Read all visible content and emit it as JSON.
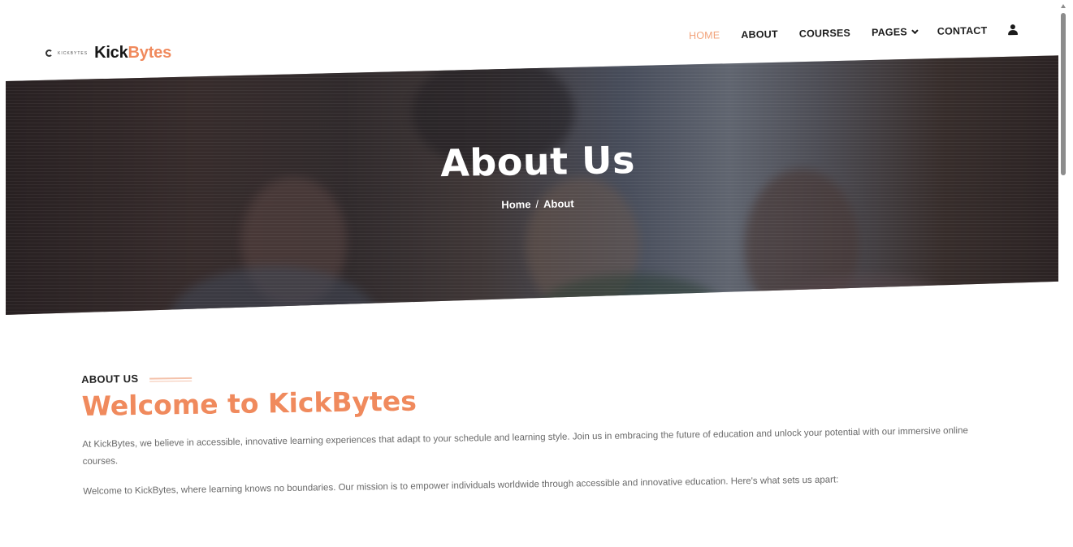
{
  "brand": {
    "tiny_text": "KICKBYTES",
    "word_dark": "Kick",
    "word_accent": "Bytes",
    "accent_color": "#f08a5d"
  },
  "nav": {
    "items": [
      {
        "label": "HOME",
        "active": true
      },
      {
        "label": "ABOUT"
      },
      {
        "label": "COURSES"
      },
      {
        "label": "PAGES",
        "has_dropdown": true
      },
      {
        "label": "CONTACT"
      }
    ],
    "user_icon": "user-icon"
  },
  "hero": {
    "title": "About Us",
    "breadcrumb": {
      "home": "Home",
      "separator": "/",
      "current": "About"
    }
  },
  "about": {
    "kicker": "ABOUT US",
    "headline": "Welcome to KickBytes",
    "paragraph_1": "At KickBytes, we believe in accessible, innovative learning experiences that adapt to your schedule and learning style. Join us in embracing the future of education and unlock your potential with our immersive online courses.",
    "paragraph_2": "Welcome to KickBytes, where learning knows no boundaries. Our mission is to empower individuals worldwide through accessible and innovative education. Here's what sets us apart:"
  }
}
